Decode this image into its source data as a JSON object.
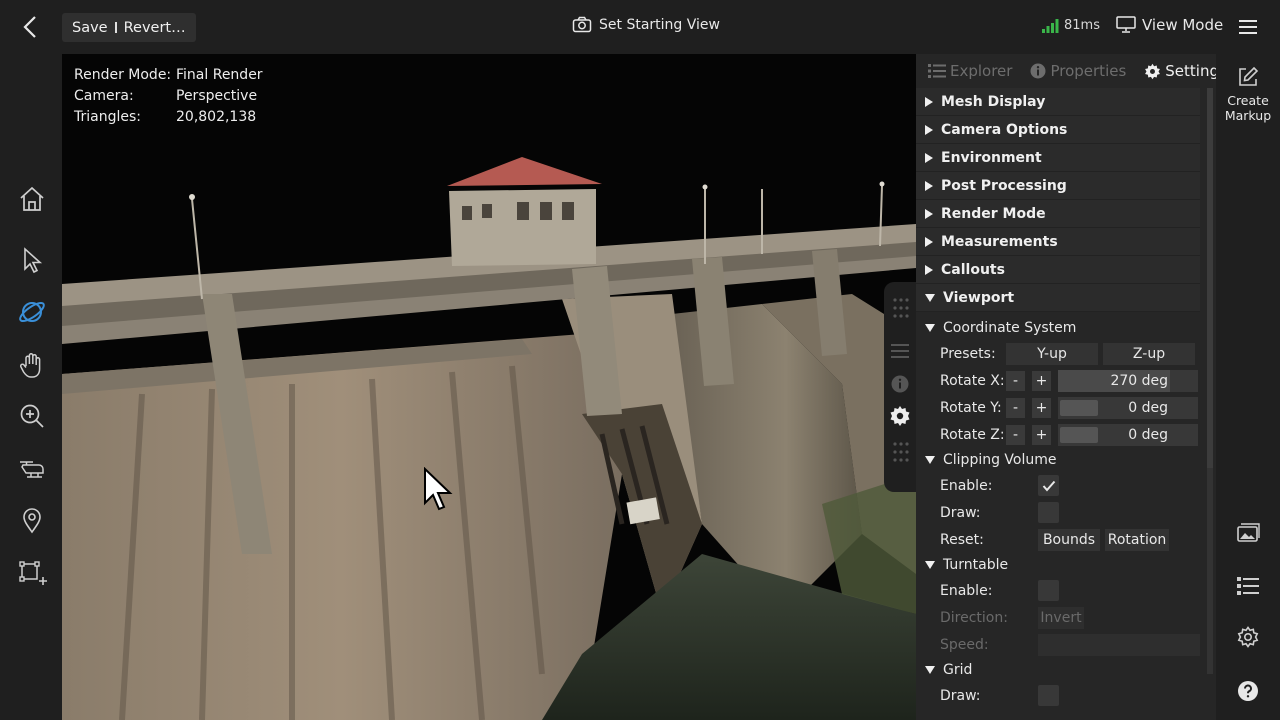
{
  "topbar": {
    "save_label": "Save",
    "revert_label": "Revert…",
    "starting_view_label": "Set Starting View",
    "latency": "81ms",
    "view_mode_label": "View Mode"
  },
  "left_tools": [
    "home-icon",
    "select-arrow-icon",
    "orbit-icon",
    "pan-hand-icon",
    "zoom-icon",
    "drone-icon",
    "location-pin-icon",
    "add-markup-area-icon"
  ],
  "viewport": {
    "render_info": [
      {
        "key": "Render Mode:",
        "value": "Final Render"
      },
      {
        "key": "Camera:",
        "value": "Perspective"
      },
      {
        "key": "Triangles:",
        "value": "20,802,138"
      }
    ]
  },
  "panel": {
    "tabs": [
      {
        "label": "Explorer",
        "icon": "list-icon",
        "active": false
      },
      {
        "label": "Properties",
        "icon": "info-icon",
        "active": false
      },
      {
        "label": "Settings",
        "icon": "gear-icon",
        "active": true
      }
    ],
    "sections": [
      "Mesh Display",
      "Camera Options",
      "Environment",
      "Post Processing",
      "Render Mode",
      "Measurements",
      "Callouts"
    ],
    "viewport_section": "Viewport",
    "coord": {
      "title": "Coordinate System",
      "presets_label": "Presets:",
      "preset_yup": "Y-up",
      "preset_zup": "Z-up",
      "rot_x_label": "Rotate X:",
      "rot_x_value": "270 deg",
      "rot_y_label": "Rotate Y:",
      "rot_y_value": "0 deg",
      "rot_z_label": "Rotate Z:",
      "rot_z_value": "0 deg",
      "minus": "-",
      "plus": "+"
    },
    "clipping": {
      "title": "Clipping Volume",
      "enable_label": "Enable:",
      "draw_label": "Draw:",
      "reset_label": "Reset:",
      "bounds_label": "Bounds",
      "rotation_label": "Rotation"
    },
    "turntable": {
      "title": "Turntable",
      "enable_label": "Enable:",
      "direction_label": "Direction:",
      "invert_label": "Invert",
      "speed_label": "Speed:"
    },
    "grid": {
      "title": "Grid",
      "draw_label": "Draw:"
    }
  },
  "rightbar": {
    "create_markup_line1": "Create",
    "create_markup_line2": "Markup"
  },
  "colors": {
    "accent_blue": "#3a8fd8",
    "signal_green": "#3ab54a",
    "panel_bg": "#262626",
    "bar_bg": "#1f1f1f"
  }
}
